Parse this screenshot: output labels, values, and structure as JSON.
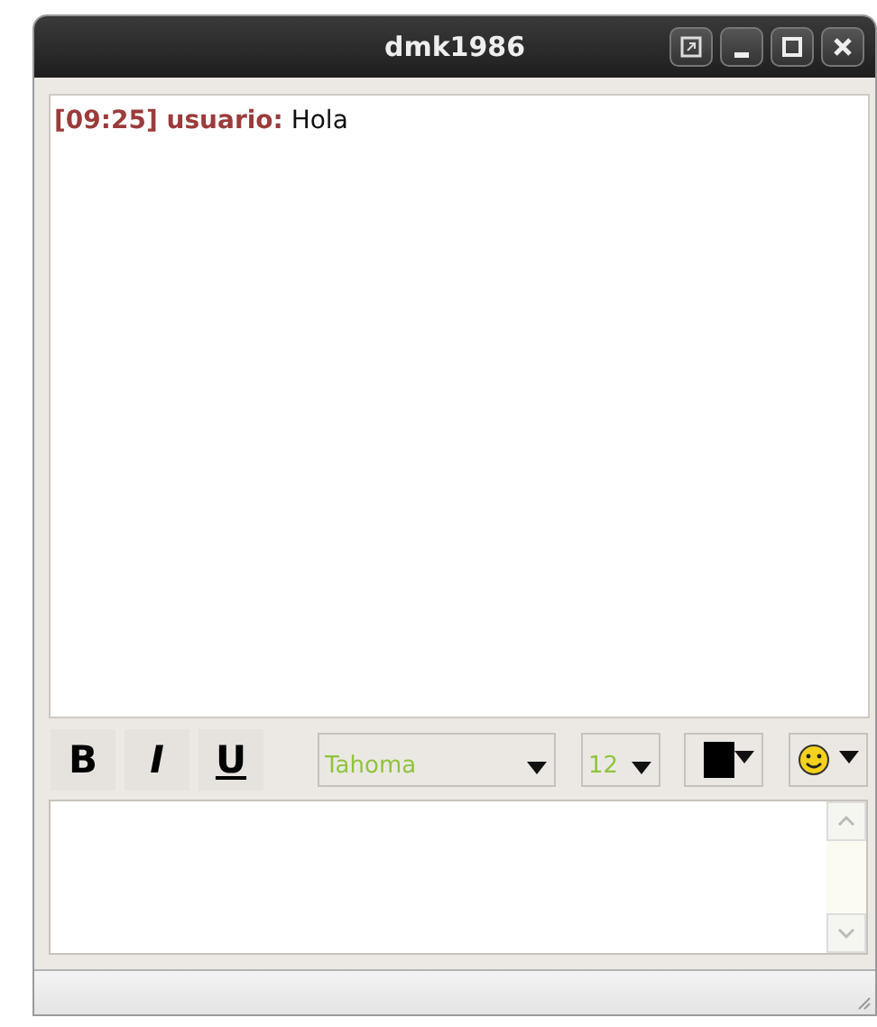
{
  "window": {
    "title": "dmk1986",
    "controls": [
      {
        "kind": "popout"
      },
      {
        "kind": "minimize"
      },
      {
        "kind": "maximize"
      },
      {
        "kind": "close"
      }
    ]
  },
  "messages": [
    {
      "time": "[09:25]",
      "user": "usuario:",
      "text": "Hola"
    }
  ],
  "format_buttons": [
    {
      "label": "B",
      "kind": "bold"
    },
    {
      "label": "I",
      "kind": "italic"
    },
    {
      "label": "U",
      "kind": "underline"
    }
  ],
  "font": "Tahoma",
  "size": "12",
  "text_color": {
    "color": "#000000"
  }
}
